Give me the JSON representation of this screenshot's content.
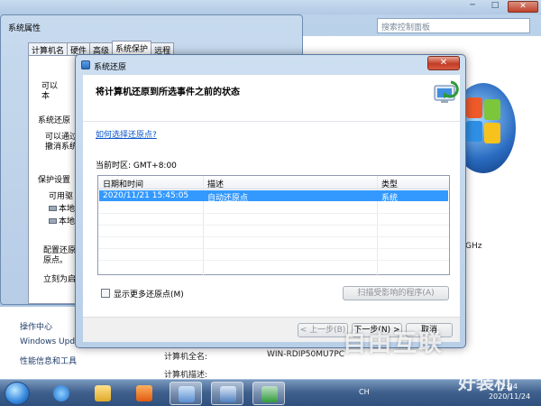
{
  "control_panel": {
    "search_placeholder": "搜索控制面板",
    "win_min": "─",
    "win_max": "□",
    "win_close": "✕",
    "help": "?",
    "left_links": [
      "操作中心",
      "Windows Update",
      "性能信息和工具"
    ],
    "info": {
      "ghz": "GHz",
      "full_name_label": "计算机全名:",
      "full_name_value": "WIN-RDIP50MU7PC",
      "desc_label": "计算机描述:"
    }
  },
  "system_properties": {
    "title": "系统属性",
    "tabs": [
      "计算机名",
      "硬件",
      "高级",
      "系统保护",
      "远程"
    ],
    "active_tab": 3,
    "body_text": {
      "can_line1": "可以",
      "can_line2": "本",
      "restore_label": "系统还原",
      "restore_line1": "可以通过",
      "restore_line2": "撤消系统",
      "protect_label": "保护设置",
      "avail_drives": "可用驱",
      "drive1": "本地",
      "drive2": "本地",
      "config1": "配置还原",
      "config2": "原点。",
      "create_now": "立刻为启"
    }
  },
  "system_restore": {
    "title": "系统还原",
    "close": "✕",
    "heading": "将计算机还原到所选事件之前的状态",
    "how_link": "如何选择还原点?",
    "timezone_label": "当前时区:",
    "timezone_value": "GMT+8:00",
    "columns": [
      "日期和时间",
      "描述",
      "类型"
    ],
    "rows": [
      {
        "date": "2020/11/21 15:45:05",
        "desc": "自动还原点",
        "type": "系统"
      }
    ],
    "show_more_label": "显示更多还原点(M)",
    "show_more_checked": false,
    "scan_button": "扫描受影响的程序(A)",
    "back_button": "< 上一步(B)",
    "next_button": "下一步(N) >",
    "cancel_button": "取消"
  },
  "taskbar": {
    "ime": "CH",
    "clock_time": "2:24",
    "clock_date": "2020/11/24"
  },
  "watermark": {
    "text1": "自由互联",
    "text2": "好装机"
  }
}
